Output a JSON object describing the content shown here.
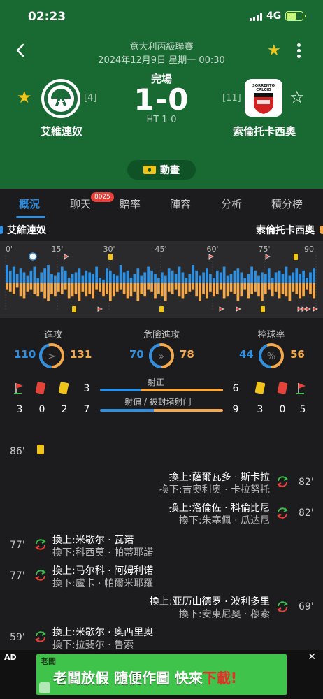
{
  "status_bar": {
    "time": "02:23",
    "network": "4G"
  },
  "match": {
    "league": "意大利丙級聯賽",
    "datetime": "2024年12月9日 星期一 00:30",
    "status": "完場",
    "score": "1-0",
    "half_time": "HT 1-0",
    "home": {
      "name": "艾維連奴",
      "rank": "[4]",
      "favorite": true
    },
    "away": {
      "name": "索倫托卡西奧",
      "rank": "[11]",
      "favorite": false,
      "logo_text": "SORRENTO CALCIO"
    },
    "animation_label": "動畫"
  },
  "tabs": [
    {
      "label": "概況",
      "active": true
    },
    {
      "label": "聊天",
      "badge": "8025"
    },
    {
      "label": "賠率"
    },
    {
      "label": "陣容"
    },
    {
      "label": "分析"
    },
    {
      "label": "積分榜"
    }
  ],
  "timeline": {
    "home_team": "艾維連奴",
    "away_team": "索倫托卡西奧",
    "minute_labels": [
      "0'",
      "15'",
      "30'",
      "45'",
      "60'",
      "75'",
      "90'"
    ],
    "home_color": "#2f8fe0",
    "away_color": "#f5a94a"
  },
  "stats": {
    "attack": {
      "label": "進攻",
      "home": "110",
      "away": "131",
      "home_share": 0.456
    },
    "dangerous_attack": {
      "label": "危險進攻",
      "home": "70",
      "away": "78",
      "home_share": 0.473
    },
    "possession": {
      "label": "控球率",
      "home": "44",
      "away": "56",
      "home_share": 0.44
    },
    "shots_on_target": {
      "label": "射正",
      "home": "3",
      "away": "6",
      "home_share": 0.333
    },
    "shots_off_blocked": {
      "label": "射偏 / 被封堵射门",
      "home": "7",
      "away": "9",
      "home_share": 0.4375
    },
    "home_counts": {
      "corners": "3",
      "red": "0",
      "yellow": "2"
    },
    "away_counts": {
      "yellow": "3",
      "red": "0",
      "corners": "5"
    }
  },
  "events": [
    {
      "minute": "86'",
      "side": "home",
      "type": "yellow"
    },
    {
      "minute": "82'",
      "side": "away",
      "type": "sub",
      "in": "換上:薩爾瓦多 · 斯卡拉",
      "out": "換下:吉奧利奧 · 卡拉努托"
    },
    {
      "minute": "82'",
      "side": "away",
      "type": "sub",
      "in": "換上:洛倫佐 · 科倫比尼",
      "out": "換下:朱塞佩 · 瓜达尼"
    },
    {
      "minute": "77'",
      "side": "home",
      "type": "sub",
      "in": "換上:米歇尔 · 瓦诺",
      "out": "換下:科西莫 · 帕蒂耶諾"
    },
    {
      "minute": "77'",
      "side": "home",
      "type": "sub",
      "in": "換上:马尔科 · 阿姆利诺",
      "out": "換下:盧卡 · 帕爾米耶羅"
    },
    {
      "minute": "69'",
      "side": "away",
      "type": "sub",
      "in": "換上:亚历山德罗 · 波利多里",
      "out": "換下:安東尼奥 · 穆索"
    },
    {
      "minute": "59'",
      "side": "home",
      "type": "sub",
      "in": "換上:米歇尔 · 奥西里奥",
      "out": "換下:拉斐尔 · 鲁索"
    }
  ],
  "ad": {
    "tag": "AD",
    "close": "✕",
    "brand": "老闆",
    "text_a": "老闆放假",
    "text_b": "隨便作圖 快來",
    "text_c": "下載!"
  }
}
